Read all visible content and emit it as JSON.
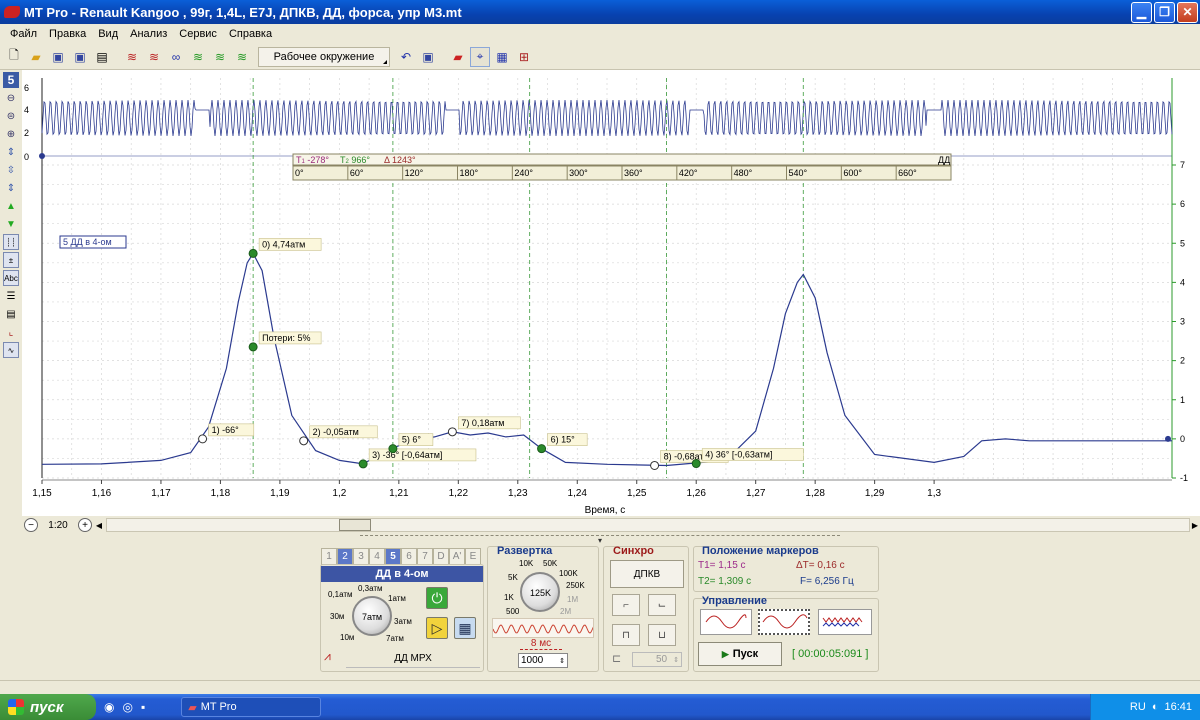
{
  "window": {
    "title": "MT Pro - Renault Kangoo , 99г, 1,4L, E7J, ДПКВ, ДД, форса, упр М3.mt"
  },
  "menu": [
    "Файл",
    "Правка",
    "Вид",
    "Анализ",
    "Сервис",
    "Справка"
  ],
  "toolbar": {
    "environment_label": "Рабочее окружение"
  },
  "left_tools": {
    "channel_number": "5"
  },
  "top_trace": {
    "y_ticks": [
      "6",
      "4",
      "2",
      "0"
    ]
  },
  "main_chart": {
    "channel_label": "5 ДД в 4-ом",
    "degree_header": {
      "t1": "-278°",
      "t2": "966°",
      "delta": "1243°",
      "name": "ДД"
    },
    "degree_ticks": [
      "0°",
      "60°",
      "120°",
      "180°",
      "240°",
      "300°",
      "360°",
      "420°",
      "480°",
      "540°",
      "600°",
      "660°"
    ],
    "annotations": [
      {
        "text": "0) 4,74атм",
        "x": 1.1855,
        "y": 4.74
      },
      {
        "text": "Потери: 5%",
        "x": 1.1855,
        "y": 2.35
      },
      {
        "text": "1) -66°",
        "x": 1.177,
        "y": 0.0
      },
      {
        "text": "2) -0,05атм",
        "x": 1.194,
        "y": -0.05
      },
      {
        "text": "3) -36° [-0,64атм]",
        "x": 1.204,
        "y": -0.64
      },
      {
        "text": "5) 6°",
        "x": 1.209,
        "y": -0.25
      },
      {
        "text": "7) 0,18атм",
        "x": 1.219,
        "y": 0.18
      },
      {
        "text": "6) 15°",
        "x": 1.234,
        "y": -0.25
      },
      {
        "text": "8) -0,68атм",
        "x": 1.253,
        "y": -0.68
      },
      {
        "text": "4) 36° [-0,63атм]",
        "x": 1.26,
        "y": -0.63
      }
    ],
    "right_ticks": [
      "7",
      "6",
      "5",
      "4",
      "3",
      "2",
      "1",
      "0",
      "-1"
    ]
  },
  "chart_data": {
    "type": "line",
    "xlabel": "Время, с",
    "ylabel": "",
    "xlim": [
      1.15,
      1.34
    ],
    "ylim": [
      -1,
      7
    ],
    "x_ticks": [
      "1,15",
      "1,16",
      "1,17",
      "1,18",
      "1,19",
      "1,2",
      "1,21",
      "1,22",
      "1,23",
      "1,24",
      "1,25",
      "1,26",
      "1,27",
      "1,28",
      "1,29",
      "1,3"
    ],
    "grid": true,
    "series": [
      {
        "name": "5 ДД в 4-ом",
        "color": "#2b3a8f",
        "x": [
          1.15,
          1.16,
          1.17,
          1.175,
          1.178,
          1.181,
          1.183,
          1.1845,
          1.1855,
          1.187,
          1.189,
          1.192,
          1.196,
          1.2,
          1.204,
          1.208,
          1.212,
          1.216,
          1.219,
          1.222,
          1.225,
          1.228,
          1.231,
          1.234,
          1.238,
          1.245,
          1.255,
          1.265,
          1.27,
          1.273,
          1.275,
          1.277,
          1.278,
          1.28,
          1.282,
          1.285,
          1.29,
          1.3,
          1.305,
          1.308,
          1.312,
          1.316,
          1.34
        ],
        "y": [
          -0.65,
          -0.64,
          -0.55,
          -0.35,
          0.3,
          1.8,
          3.5,
          4.5,
          4.74,
          4.3,
          2.6,
          0.6,
          -0.3,
          -0.55,
          -0.64,
          -0.3,
          -0.05,
          0.05,
          0.18,
          0.1,
          0.15,
          0.05,
          0.1,
          -0.25,
          -0.6,
          -0.65,
          -0.68,
          -0.55,
          0.2,
          1.8,
          3.2,
          4.0,
          4.2,
          3.6,
          2.2,
          0.6,
          -0.4,
          -0.6,
          -0.45,
          -0.05,
          0.0,
          -0.05,
          -0.05
        ]
      }
    ],
    "cursors": [
      {
        "x": 1.1855,
        "color": "#3a9a3a"
      },
      {
        "x": 1.209,
        "color": "#3a9a3a"
      },
      {
        "x": 1.232,
        "color": "#3a9a3a"
      },
      {
        "x": 1.255,
        "color": "#3a9a3a"
      },
      {
        "x": 1.278,
        "color": "#3a9a3a"
      }
    ]
  },
  "bottom_scale": {
    "zoom": "1:20"
  },
  "channel_panel": {
    "tabs": [
      "1",
      "2",
      "3",
      "4",
      "5",
      "6",
      "7",
      "D",
      "A'",
      "E"
    ],
    "header": "ДД в 4-ом",
    "knob_labels": [
      "0,1атм",
      "0,3атм",
      "1атм",
      "3атм",
      "7атм",
      "10м",
      "30м"
    ],
    "knob_value": "7атм",
    "probe_label": "ДД МРХ"
  },
  "sweep_panel": {
    "title": "Развертка",
    "knob_labels": [
      "10K",
      "50K",
      "100K",
      "5K",
      "250K",
      "1K",
      "1M",
      "500",
      "2M"
    ],
    "knob_value": "125K",
    "time_label": "8 мс",
    "points": "1000"
  },
  "sync_panel": {
    "title": "Синхро",
    "source": "ДПКВ",
    "level": "50"
  },
  "markers_panel": {
    "title": "Положение маркеров",
    "t1": "T1= 1,15 с",
    "dt": "ΔT= 0,16 с",
    "t2": "T2= 1,309 с",
    "f": "F= 6,256 Гц"
  },
  "control_panel": {
    "title": "Управление",
    "start": "Пуск",
    "timer": "[ 00:00:05:091 ]"
  },
  "taskbar": {
    "start": "пуск",
    "task": "MT Pro",
    "lang": "RU",
    "time": "16:41"
  }
}
